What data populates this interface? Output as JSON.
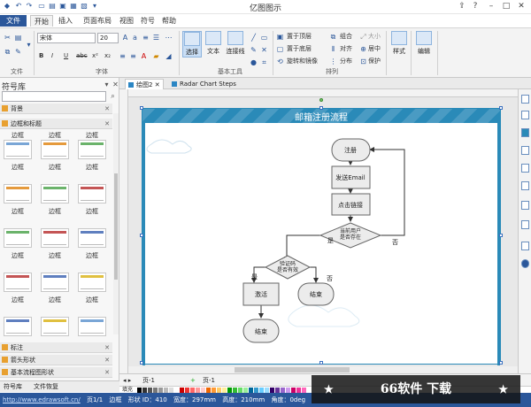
{
  "window": {
    "title": "亿图图示"
  },
  "menu_tabs": [
    "文件",
    "开始",
    "插入",
    "页面布局",
    "视图",
    "符号",
    "帮助"
  ],
  "ribbon": {
    "font_name": "宋体",
    "font_size": "20",
    "groups": {
      "file": "文件",
      "font": "字体",
      "basic_tools": "基本工具",
      "arrange": "排列"
    },
    "tools": {
      "select": "选择",
      "text": "文本",
      "connector": "连接线",
      "style": "样式",
      "edit": "编辑"
    },
    "arrange_buttons": {
      "bring_front": "置于顶层",
      "send_back": "置于底层",
      "rotate_mirror": "旋转和镜像",
      "group": "组合",
      "align": "对齐",
      "distribute": "分布",
      "size": "大小",
      "center": "居中",
      "protect": "保护"
    },
    "text_styles": [
      "B",
      "I",
      "U",
      "abc",
      "x²",
      "x₂"
    ]
  },
  "library": {
    "title": "符号库",
    "categories": {
      "background": "背景",
      "border_title": "边框和标题",
      "annotation": "标注",
      "arrows": "箭头形状",
      "basic_flowchart": "基本流程图形状"
    },
    "frame_label": "边框"
  },
  "doc_tabs": [
    {
      "label": "绘图2"
    },
    {
      "label": "Radar Chart Steps"
    }
  ],
  "diagram": {
    "title": "邮箱注册流程",
    "nodes": {
      "register": "注册",
      "send_email": "发送Email",
      "click_link": "点击链接",
      "user_exists": "当前用户是否存在",
      "code_valid": "验证码是否有效",
      "activate": "激活",
      "end1": "结束",
      "end2": "结束"
    },
    "edges": {
      "yes1": "是",
      "no1": "否",
      "yes2": "是",
      "no2": "否"
    }
  },
  "page_tabs": [
    "页-1",
    "页-1"
  ],
  "palette_label": "填充",
  "bottom_tabs": [
    "符号库",
    "文件恢复"
  ],
  "status": {
    "url": "http://www.edrawsoft.cn/",
    "page": "页1/1",
    "shape": "边框",
    "shape_id": "形状 ID：410",
    "width": "宽度：297mm",
    "height": "高度：210mm",
    "angle": "角度：0deg"
  },
  "watermark": "66软件 下载",
  "colors": {
    "accent": "#2b579a",
    "page_band": "#2a8ab8",
    "node_fill": "#ececec"
  }
}
